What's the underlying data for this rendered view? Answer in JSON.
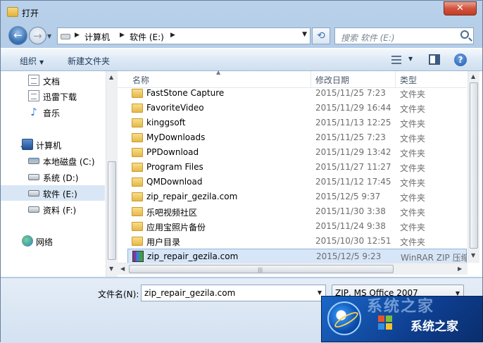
{
  "window": {
    "title": "打开",
    "close_glyph": "✕"
  },
  "navigation": {
    "back_glyph": "←",
    "forward_glyph": "→",
    "breadcrumb": [
      "计算机",
      "软件 (E:)"
    ],
    "search_placeholder": "搜索 软件 (E:)"
  },
  "toolbar": {
    "organize_label": "组织",
    "new_folder_label": "新建文件夹"
  },
  "sidebar": {
    "items": [
      {
        "label": "文档",
        "icon": "document-icon"
      },
      {
        "label": "迅雷下载",
        "icon": "document-icon"
      },
      {
        "label": "音乐",
        "icon": "music-icon"
      },
      {
        "label": "计算机",
        "icon": "computer-icon"
      },
      {
        "label": "本地磁盘 (C:)",
        "icon": "drive-icon"
      },
      {
        "label": "系统 (D:)",
        "icon": "drive-icon"
      },
      {
        "label": "软件 (E:)",
        "icon": "drive-icon"
      },
      {
        "label": "资料 (F:)",
        "icon": "drive-icon"
      },
      {
        "label": "网络",
        "icon": "network-icon"
      }
    ],
    "selected": "软件 (E:)"
  },
  "file_list": {
    "columns": [
      "名称",
      "修改日期",
      "类型"
    ],
    "rows": [
      {
        "name": "FastStone Capture",
        "date": "2015/11/25 7:23",
        "type": "文件夹",
        "icon": "folder-icon"
      },
      {
        "name": "FavoriteVideo",
        "date": "2015/11/29 16:44",
        "type": "文件夹",
        "icon": "folder-icon"
      },
      {
        "name": "kinggsoft",
        "date": "2015/11/13 12:25",
        "type": "文件夹",
        "icon": "folder-icon"
      },
      {
        "name": "MyDownloads",
        "date": "2015/11/25 7:23",
        "type": "文件夹",
        "icon": "folder-icon"
      },
      {
        "name": "PPDownload",
        "date": "2015/11/29 13:42",
        "type": "文件夹",
        "icon": "folder-icon"
      },
      {
        "name": "Program Files",
        "date": "2015/11/27 11:27",
        "type": "文件夹",
        "icon": "folder-icon"
      },
      {
        "name": "QMDownload",
        "date": "2015/11/12 17:45",
        "type": "文件夹",
        "icon": "folder-icon"
      },
      {
        "name": "zip_repair_gezila.com",
        "date": "2015/12/5 9:37",
        "type": "文件夹",
        "icon": "folder-icon"
      },
      {
        "name": "乐吧视频社区",
        "date": "2015/11/30 3:38",
        "type": "文件夹",
        "icon": "folder-icon"
      },
      {
        "name": "应用宝照片备份",
        "date": "2015/11/24 9:38",
        "type": "文件夹",
        "icon": "folder-icon"
      },
      {
        "name": "用户目录",
        "date": "2015/10/30 12:51",
        "type": "文件夹",
        "icon": "folder-icon"
      },
      {
        "name": "zip_repair_gezila.com",
        "date": "2015/12/5 9:23",
        "type": "WinRAR ZIP 压缩",
        "icon": "winrar-icon"
      }
    ],
    "selected_row": 11
  },
  "bottom": {
    "filename_label": "文件名(N):",
    "filename_value": "zip_repair_gezila.com",
    "filetype_value": "ZIP, MS Office 2007"
  },
  "watermark": {
    "text": "系统之家",
    "faded_text": "系统之家"
  }
}
